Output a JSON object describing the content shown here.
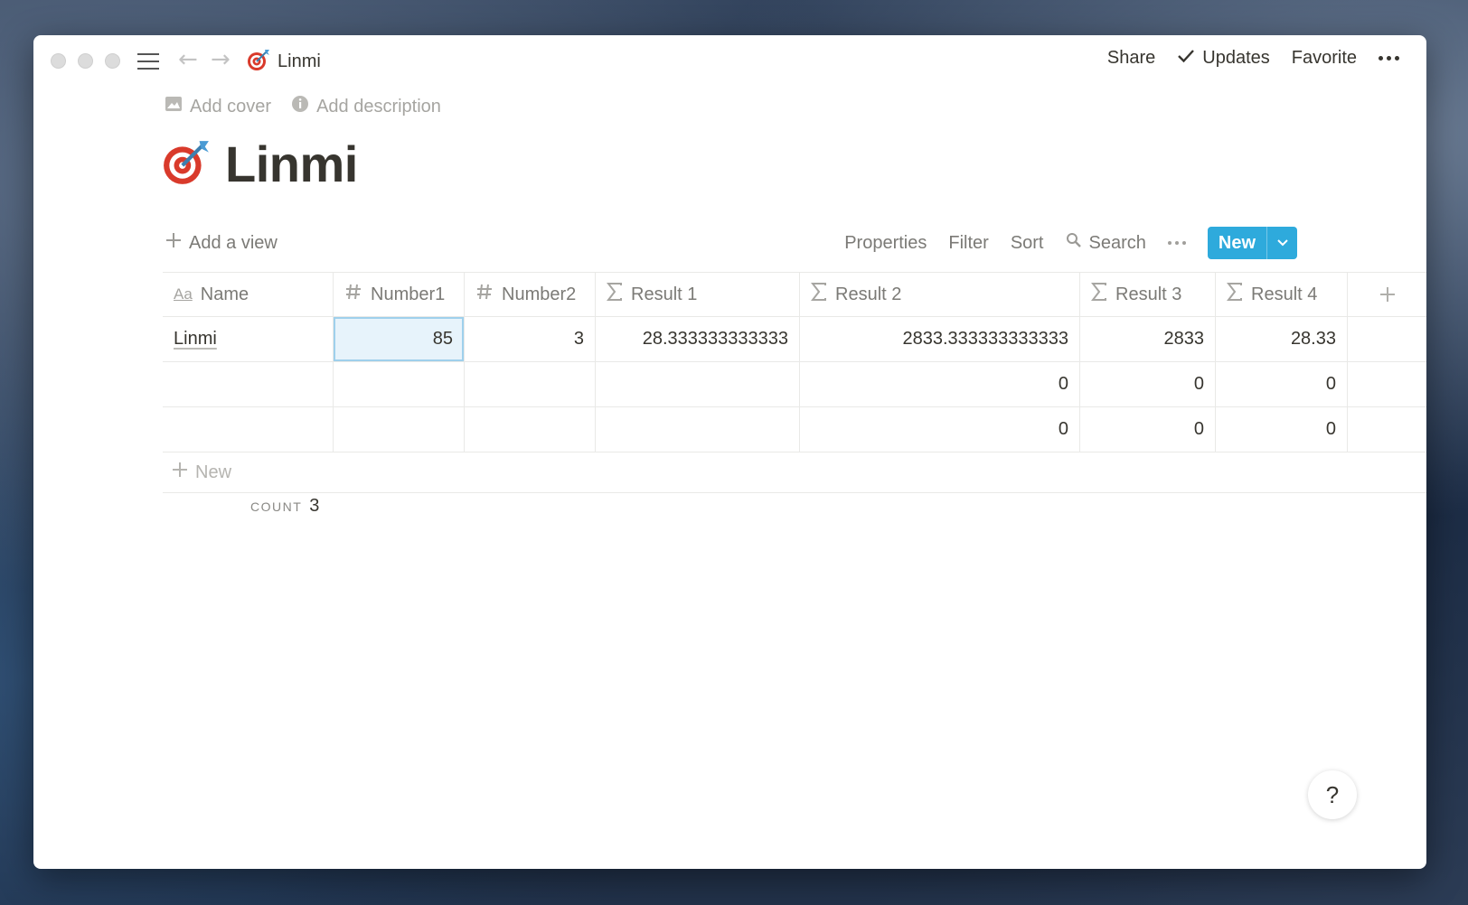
{
  "titlebar": {
    "breadcrumb_title": "Linmi",
    "breadcrumb_icon": "target-icon",
    "share_label": "Share",
    "updates_label": "Updates",
    "favorite_label": "Favorite"
  },
  "page": {
    "add_cover_label": "Add cover",
    "add_description_label": "Add description",
    "title": "Linmi",
    "icon": "target-icon"
  },
  "view_toolbar": {
    "add_view_label": "Add a view",
    "properties_label": "Properties",
    "filter_label": "Filter",
    "sort_label": "Sort",
    "search_label": "Search",
    "new_label": "New"
  },
  "table": {
    "columns": [
      {
        "label": "Name",
        "icon": "text-icon"
      },
      {
        "label": "Number1",
        "icon": "hash-icon"
      },
      {
        "label": "Number2",
        "icon": "hash-icon"
      },
      {
        "label": "Result 1",
        "icon": "sigma-icon"
      },
      {
        "label": "Result 2",
        "icon": "sigma-icon"
      },
      {
        "label": "Result 3",
        "icon": "sigma-icon"
      },
      {
        "label": "Result 4",
        "icon": "sigma-icon"
      }
    ],
    "rows": [
      [
        "Linmi",
        "85",
        "3",
        "28.333333333333",
        "2833.333333333333",
        "2833",
        "28.33"
      ],
      [
        "",
        "",
        "",
        "",
        "0",
        "0",
        "0"
      ],
      [
        "",
        "",
        "",
        "",
        "0",
        "0",
        "0"
      ]
    ],
    "add_row_label": "New",
    "count_label": "COUNT",
    "count_value": "3"
  },
  "help_label": "?",
  "colors": {
    "accent": "#2eaadc",
    "text": "#37352f",
    "muted": "#7b7a76",
    "selected_cell": "#e7f3fb"
  }
}
